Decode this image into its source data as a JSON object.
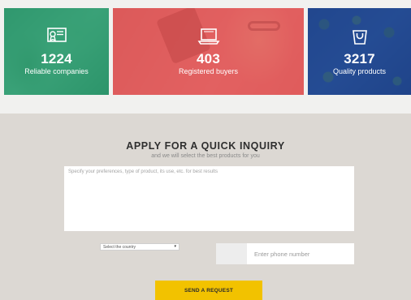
{
  "stats": [
    {
      "number": "1224",
      "label": "Reliable companies",
      "icon": "certificate-icon",
      "color": "#28a573"
    },
    {
      "number": "403",
      "label": "Registered buyers",
      "icon": "laptop-icon",
      "color": "#e15555"
    },
    {
      "number": "3217",
      "label": "Quality products",
      "icon": "shopping-bag-icon",
      "color": "#1e4696"
    }
  ],
  "inquiry": {
    "title": "APPLY FOR A QUICK INQUIRY",
    "subtitle": "and we will select the best products for you",
    "message_placeholder": "Specify your preferences, type of product, its use, etc. for best results",
    "country_select": {
      "selected": "Select the country"
    },
    "phone_placeholder": "Enter phone number",
    "submit_label": "SEND A REQUEST"
  },
  "colors": {
    "accent_button": "#f2c200",
    "section_background": "#dcd8d3",
    "strip_background": "#f1f1ef"
  }
}
